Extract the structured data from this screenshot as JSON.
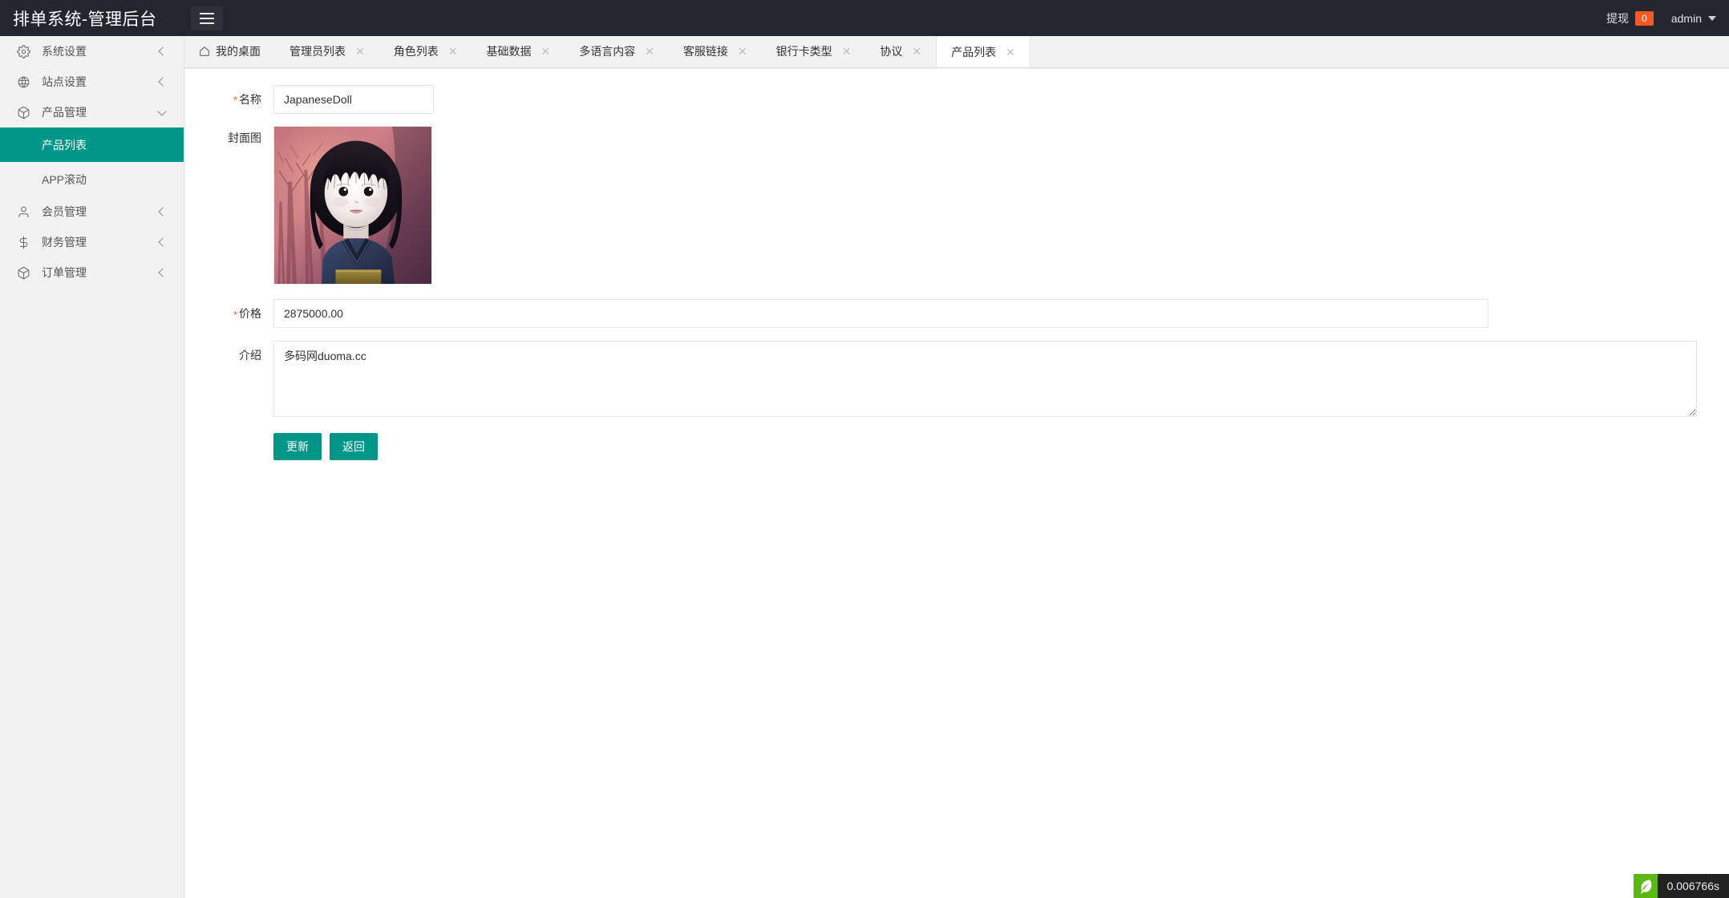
{
  "header": {
    "title": "排单系统-管理后台",
    "menu_toggle_icon": "hamburger-icon",
    "withdraw_label": "提现",
    "withdraw_count": "0",
    "user_name": "admin",
    "caret_icon": "chevron-down-icon",
    "bg_color": "#23262e"
  },
  "sidebar": {
    "items": [
      {
        "label": "系统设置",
        "icon": "gear-icon",
        "arrow": "chevron-left-icon",
        "expanded": false
      },
      {
        "label": "站点设置",
        "icon": "globe-icon",
        "arrow": "chevron-left-icon",
        "expanded": false
      },
      {
        "label": "产品管理",
        "icon": "cube-icon",
        "arrow": "chevron-down-icon",
        "expanded": true
      },
      {
        "label": "会员管理",
        "icon": "user-icon",
        "arrow": "chevron-left-icon",
        "expanded": false
      },
      {
        "label": "财务管理",
        "icon": "dollar-icon",
        "arrow": "chevron-left-icon",
        "expanded": false
      },
      {
        "label": "订单管理",
        "icon": "cube-icon",
        "arrow": "chevron-left-icon",
        "expanded": false
      }
    ],
    "sub_items": [
      {
        "label": "产品列表",
        "active": true
      },
      {
        "label": "APP滚动",
        "active": false
      }
    ],
    "active_color": "#009688"
  },
  "tabs": [
    {
      "label": "我的桌面",
      "icon": "home-icon",
      "closable": false,
      "active": false
    },
    {
      "label": "管理员列表",
      "closable": true,
      "active": false
    },
    {
      "label": "角色列表",
      "closable": true,
      "active": false
    },
    {
      "label": "基础数据",
      "closable": true,
      "active": false
    },
    {
      "label": "多语言内容",
      "closable": true,
      "active": false
    },
    {
      "label": "客服链接",
      "closable": true,
      "active": false
    },
    {
      "label": "银行卡类型",
      "closable": true,
      "active": false
    },
    {
      "label": "协议",
      "closable": true,
      "active": false
    },
    {
      "label": "产品列表",
      "closable": true,
      "active": true
    }
  ],
  "form": {
    "name": {
      "label": "名称",
      "required": true,
      "value": "JapaneseDoll",
      "placeholder": ""
    },
    "cover": {
      "label": "封面图",
      "required": false,
      "alt": "JapaneseDoll 封面图"
    },
    "price": {
      "label": "价格",
      "required": true,
      "value": "2875000.00",
      "placeholder": ""
    },
    "intro": {
      "label": "介绍",
      "required": false,
      "value": "多码网duoma.cc",
      "placeholder": ""
    },
    "submit_label": "更新",
    "back_label": "返回",
    "button_color": "#009688"
  },
  "debugbar": {
    "icon": "leaf-icon",
    "time": "0.006766s"
  }
}
